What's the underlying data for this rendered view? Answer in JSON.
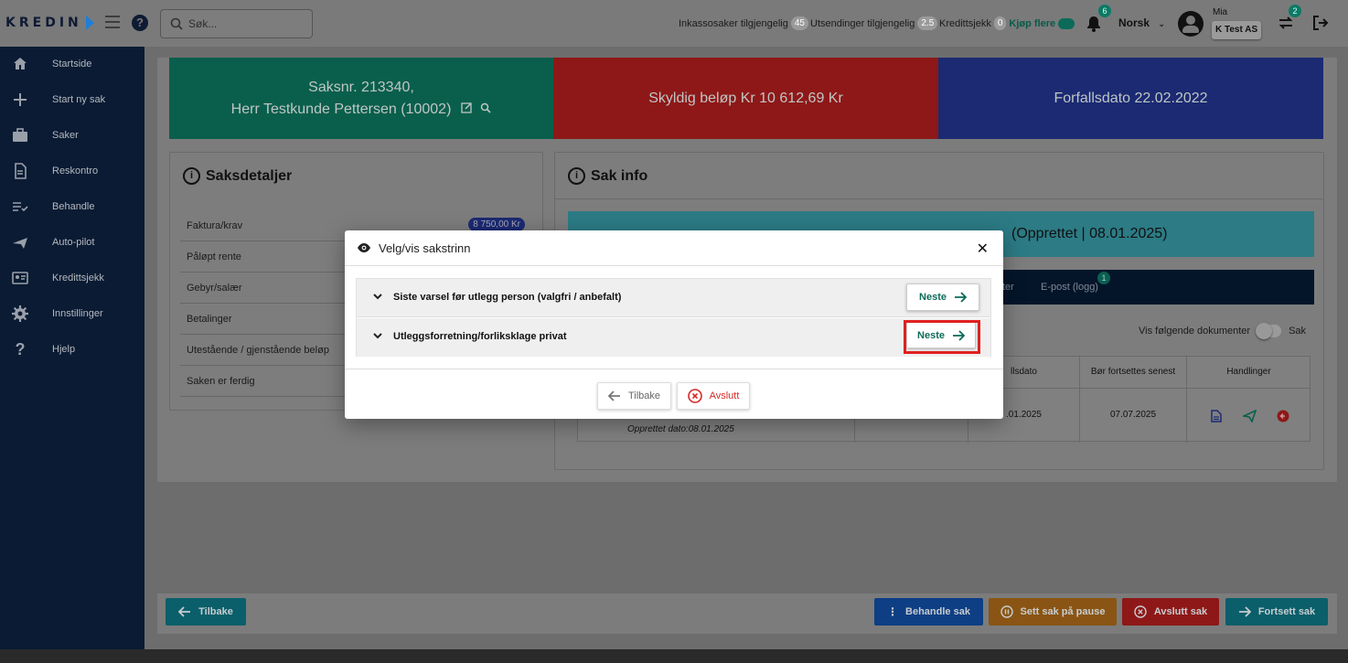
{
  "header": {
    "logo": "KREDIN",
    "search_placeholder": "Søk...",
    "stats": [
      {
        "label": "Inkassosaker tilgjengelig",
        "value": "45"
      },
      {
        "label": "Utsendinger tilgjengelig",
        "value": "2.5"
      },
      {
        "label": "Kredittsjekk",
        "value": "0"
      }
    ],
    "buy_more": "Kjøp flere",
    "notifications_count": "6",
    "language": "Norsk",
    "user_name": "Mia",
    "company": "K Test AS",
    "switch_count": "2"
  },
  "sidebar": {
    "items": [
      {
        "label": "Startside",
        "icon": "home-icon"
      },
      {
        "label": "Start ny sak",
        "icon": "plus-icon"
      },
      {
        "label": "Saker",
        "icon": "briefcase-icon"
      },
      {
        "label": "Reskontro",
        "icon": "document-icon"
      },
      {
        "label": "Behandle",
        "icon": "checklist-icon"
      },
      {
        "label": "Auto-pilot",
        "icon": "airplane-icon"
      },
      {
        "label": "Kredittsjekk",
        "icon": "id-card-icon"
      },
      {
        "label": "Innstillinger",
        "icon": "gear-icon"
      },
      {
        "label": "Hjelp",
        "icon": "question-icon"
      }
    ]
  },
  "banners": {
    "case_line1": "Saksnr. 213340,",
    "case_line2": "Herr Testkunde Pettersen (10002)",
    "amount_due": "Skyldig beløp Kr 10 612,69 Kr",
    "due_date": "Forfallsdato  22.02.2022"
  },
  "saksdetaljer": {
    "title": "Saksdetaljer",
    "rows": [
      {
        "label": "Faktura/krav",
        "value": "8 750,00 Kr"
      },
      {
        "label": "Påløpt rente"
      },
      {
        "label": "Gebyr/salær"
      },
      {
        "label": "Betalinger"
      },
      {
        "label": "Utestående / gjenstående beløp"
      },
      {
        "label": "Saken er ferdig"
      }
    ]
  },
  "sakinfo": {
    "title": "Sak info",
    "status_text": "(Opprettet | 08.01.2025)",
    "tabs": [
      {
        "label": "ter"
      },
      {
        "label": "E-post (logg)",
        "badge": "1"
      }
    ],
    "show_docs_label": "Vis følgende dokumenter",
    "show_docs_suffix": "Sak",
    "table": {
      "headers": [
        "llsdato",
        "Bør fortsettes senest",
        "Handlinger"
      ],
      "row": {
        "date1": ".01.2025",
        "date2": "07.07.2025",
        "created": "Opprettet dato:08.01.2025"
      }
    }
  },
  "bottom_actions": {
    "back": "Tilbake",
    "process": "Behandle sak",
    "pause": "Sett sak på pause",
    "end": "Avslutt sak",
    "continue": "Fortsett sak"
  },
  "modal": {
    "title": "Velg/vis sakstrinn",
    "steps": [
      {
        "label": "Siste varsel før utlegg person (valgfri / anbefalt)",
        "button": "Neste"
      },
      {
        "label": "Utleggsforretning/forliksklage privat",
        "button": "Neste"
      }
    ],
    "back": "Tilbake",
    "cancel": "Avslutt"
  },
  "colors": {
    "green": "#0b6b58",
    "red": "#d72828",
    "navy": "#0a1b33",
    "highlight": "#e02020"
  }
}
